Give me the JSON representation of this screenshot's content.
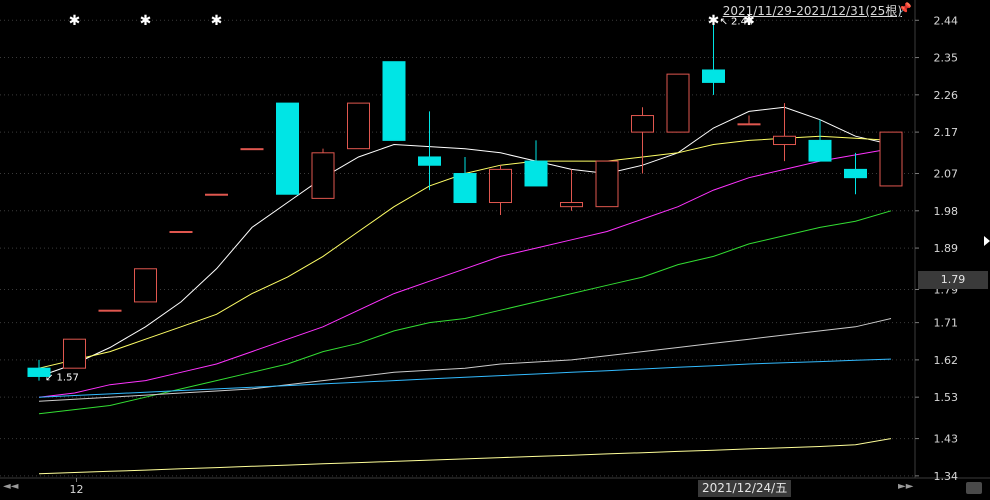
{
  "header": {
    "range_label": "2021/11/29-2021/12/31(25根)",
    "pin_icon": "pin-icon"
  },
  "cursor": {
    "price_label": "1.79",
    "date_label": "2021/12/24/五"
  },
  "x_axis": {
    "labels": [
      {
        "index": 1,
        "text": "12"
      }
    ]
  },
  "colors": {
    "up_candle": "#e0574f",
    "down_candle": "#00e5e5",
    "ma_lines": [
      "#ffffff",
      "#ffff66",
      "#ff33ff",
      "#33dd33",
      "#cccccc",
      "#33bbff",
      "#ffff99"
    ]
  },
  "chart_data": {
    "type": "candlestick",
    "y_ticks": [
      "2.44",
      "2.35",
      "2.26",
      "2.17",
      "2.07",
      "1.98",
      "1.89",
      "1.79",
      "1.71",
      "1.62",
      "1.53",
      "1.43",
      "1.34"
    ],
    "ylim": [
      1.33,
      2.46
    ],
    "candles": [
      {
        "open": 1.6,
        "high": 1.62,
        "low": 1.57,
        "close": 1.58
      },
      {
        "open": 1.6,
        "high": 1.67,
        "low": 1.6,
        "close": 1.67
      },
      {
        "open": 1.74,
        "high": 1.74,
        "low": 1.74,
        "close": 1.74
      },
      {
        "open": 1.76,
        "high": 1.84,
        "low": 1.76,
        "close": 1.84
      },
      {
        "open": 1.93,
        "high": 1.93,
        "low": 1.93,
        "close": 1.93
      },
      {
        "open": 2.02,
        "high": 2.02,
        "low": 2.02,
        "close": 2.02
      },
      {
        "open": 2.13,
        "high": 2.13,
        "low": 2.13,
        "close": 2.13
      },
      {
        "open": 2.24,
        "high": 2.24,
        "low": 2.02,
        "close": 2.02
      },
      {
        "open": 2.01,
        "high": 2.13,
        "low": 2.01,
        "close": 2.12
      },
      {
        "open": 2.13,
        "high": 2.24,
        "low": 2.13,
        "close": 2.24
      },
      {
        "open": 2.34,
        "high": 2.34,
        "low": 2.15,
        "close": 2.15
      },
      {
        "open": 2.11,
        "high": 2.22,
        "low": 2.03,
        "close": 2.09
      },
      {
        "open": 2.07,
        "high": 2.11,
        "low": 2.0,
        "close": 2.0
      },
      {
        "open": 2.0,
        "high": 2.09,
        "low": 1.97,
        "close": 2.08
      },
      {
        "open": 2.1,
        "high": 2.15,
        "low": 2.04,
        "close": 2.04
      },
      {
        "open": 1.99,
        "high": 2.08,
        "low": 1.98,
        "close": 2.0
      },
      {
        "open": 1.99,
        "high": 2.1,
        "low": 1.99,
        "close": 2.1
      },
      {
        "open": 2.17,
        "high": 2.23,
        "low": 2.07,
        "close": 2.21
      },
      {
        "open": 2.17,
        "high": 2.31,
        "low": 2.17,
        "close": 2.31
      },
      {
        "open": 2.32,
        "high": 2.44,
        "low": 2.26,
        "close": 2.29
      },
      {
        "open": 2.19,
        "high": 2.21,
        "low": 2.19,
        "close": 2.19
      },
      {
        "open": 2.14,
        "high": 2.24,
        "low": 2.1,
        "close": 2.16
      },
      {
        "open": 2.15,
        "high": 2.2,
        "low": 2.1,
        "close": 2.1
      },
      {
        "open": 2.08,
        "high": 2.12,
        "low": 2.02,
        "close": 2.06
      },
      {
        "open": 2.04,
        "high": 2.17,
        "low": 2.04,
        "close": 2.17
      }
    ],
    "star_markers": [
      1,
      3,
      5,
      19,
      20
    ],
    "annotations": [
      {
        "index": 0,
        "price": 1.57,
        "text": "1.57",
        "arrow": "↙"
      },
      {
        "index": 19,
        "price": 2.44,
        "text": "2.44",
        "arrow": "↖"
      }
    ],
    "ma_series": [
      {
        "values": [
          1.58,
          1.61,
          1.65,
          1.7,
          1.76,
          1.84,
          1.94,
          2.0,
          2.06,
          2.11,
          2.14,
          2.135,
          2.13,
          2.12,
          2.1,
          2.08,
          2.07,
          2.09,
          2.12,
          2.18,
          2.22,
          2.23,
          2.2,
          2.16,
          2.14
        ]
      },
      {
        "values": [
          1.6,
          1.62,
          1.64,
          1.67,
          1.7,
          1.73,
          1.78,
          1.82,
          1.87,
          1.93,
          1.99,
          2.04,
          2.07,
          2.09,
          2.1,
          2.1,
          2.1,
          2.11,
          2.12,
          2.14,
          2.15,
          2.155,
          2.16,
          2.155,
          2.15
        ]
      },
      {
        "values": [
          1.53,
          1.54,
          1.56,
          1.57,
          1.59,
          1.61,
          1.64,
          1.67,
          1.7,
          1.74,
          1.78,
          1.81,
          1.84,
          1.87,
          1.89,
          1.91,
          1.93,
          1.96,
          1.99,
          2.03,
          2.06,
          2.08,
          2.1,
          2.115,
          2.13
        ]
      },
      {
        "values": [
          1.49,
          1.5,
          1.51,
          1.53,
          1.55,
          1.57,
          1.59,
          1.61,
          1.64,
          1.66,
          1.69,
          1.71,
          1.72,
          1.74,
          1.76,
          1.78,
          1.8,
          1.82,
          1.85,
          1.87,
          1.9,
          1.92,
          1.94,
          1.955,
          1.98
        ]
      },
      {
        "values": [
          1.52,
          1.525,
          1.53,
          1.535,
          1.54,
          1.545,
          1.55,
          1.56,
          1.57,
          1.58,
          1.59,
          1.595,
          1.6,
          1.61,
          1.615,
          1.62,
          1.63,
          1.64,
          1.65,
          1.66,
          1.67,
          1.68,
          1.69,
          1.7,
          1.72
        ]
      },
      {
        "values": [
          1.53,
          1.534,
          1.538,
          1.542,
          1.546,
          1.55,
          1.554,
          1.558,
          1.562,
          1.566,
          1.57,
          1.574,
          1.578,
          1.582,
          1.586,
          1.59,
          1.594,
          1.598,
          1.602,
          1.606,
          1.61,
          1.613,
          1.616,
          1.619,
          1.622
        ]
      },
      {
        "values": [
          1.345,
          1.348,
          1.351,
          1.354,
          1.357,
          1.36,
          1.363,
          1.366,
          1.369,
          1.372,
          1.375,
          1.378,
          1.381,
          1.384,
          1.387,
          1.39,
          1.393,
          1.396,
          1.399,
          1.402,
          1.405,
          1.408,
          1.411,
          1.415,
          1.43
        ]
      }
    ]
  }
}
